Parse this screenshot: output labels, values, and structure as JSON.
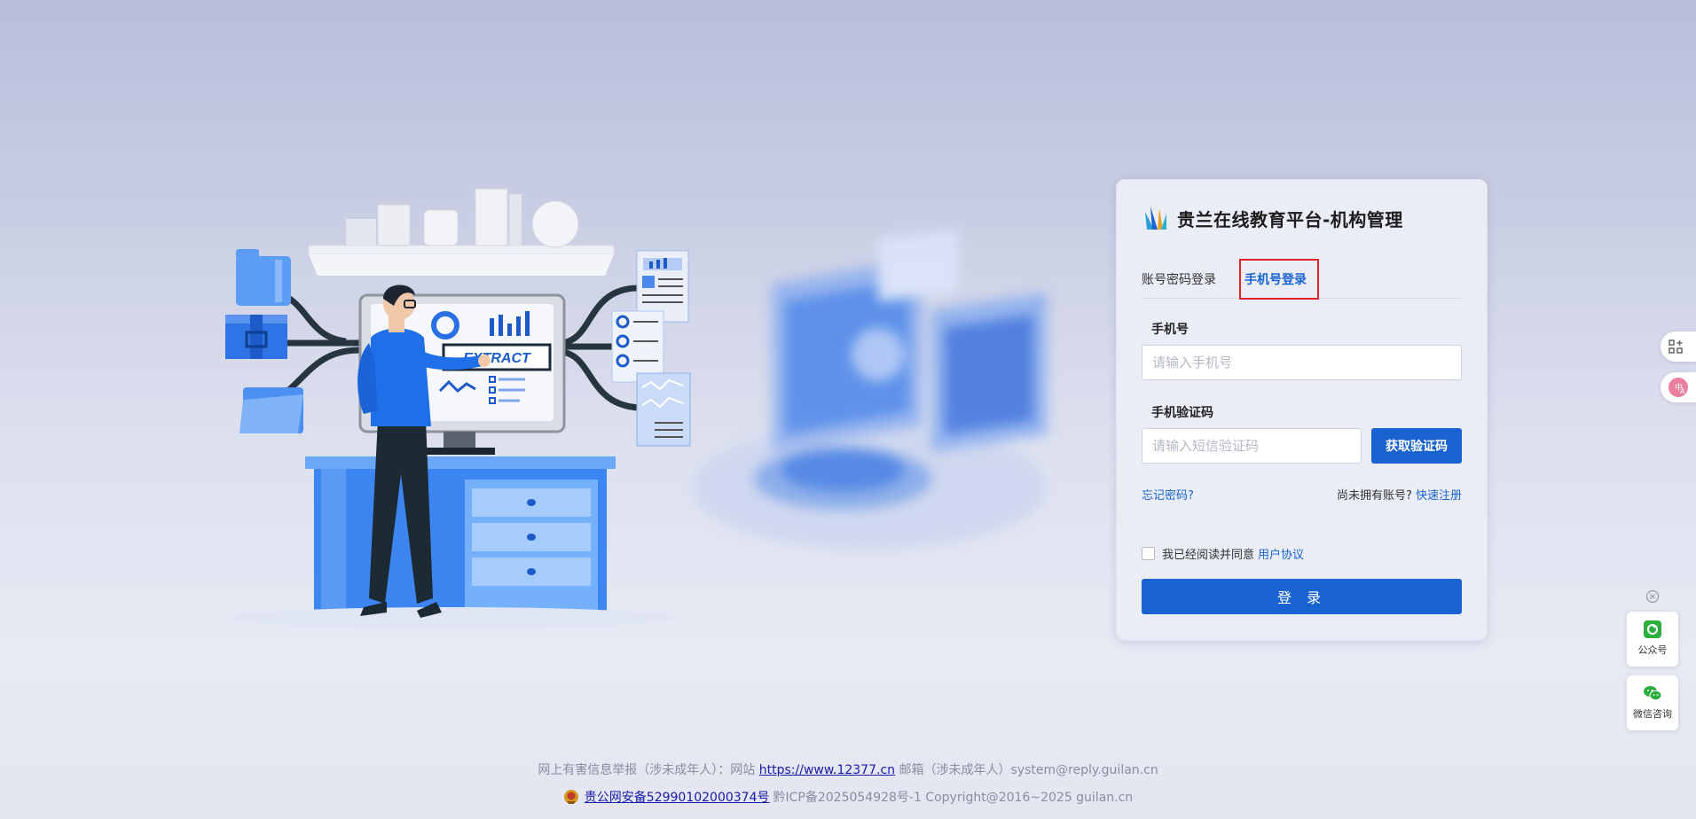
{
  "brand": {
    "title": "贵兰在线教育平台-机构管理"
  },
  "illustration": {
    "screen_text": "EXTRACT"
  },
  "tabs": [
    {
      "label": "账号密码登录",
      "active": false
    },
    {
      "label": "手机号登录",
      "active": true
    }
  ],
  "form": {
    "phone_label": "手机号",
    "phone_placeholder": "请输入手机号",
    "code_label": "手机验证码",
    "code_placeholder": "请输入短信验证码",
    "get_code_label": "获取验证码",
    "forgot_label": "忘记密码?",
    "no_account_text": "尚未拥有账号?",
    "register_label": "快速注册",
    "agree_text": "我已经阅读并同意",
    "agreement_link": "用户协议",
    "login_label": "登 录"
  },
  "floating": {
    "official_account": "公众号",
    "wechat_consult": "微信咨询"
  },
  "footer": {
    "line1_prefix": "网上有害信息举报（涉未成年人）：网站",
    "line1_link": "https://www.12377.cn",
    "line1_suffix": "邮箱（涉未成年人）system@reply.guilan.cn",
    "police_link": "贵公网安备52990102000374号",
    "line2_suffix": "黔ICP备2025054928号-1 Copyright@2016~2025 guilan.cn"
  },
  "colors": {
    "primary": "#1863d0",
    "highlight_border": "#e0202a",
    "wechat_green": "#2bae3e"
  }
}
